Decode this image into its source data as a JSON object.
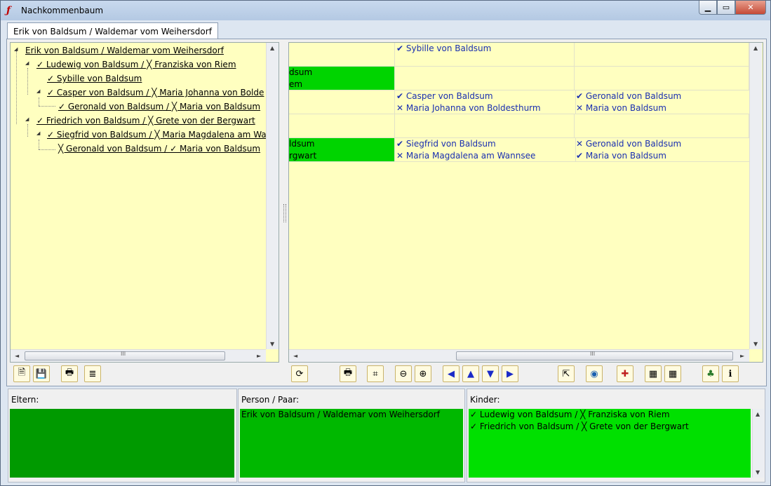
{
  "window": {
    "title": "Nachkommenbaum",
    "buttons": {
      "minimize": "▁",
      "maximize": "▭",
      "close": "✕"
    }
  },
  "tab": {
    "label": "Erik von Baldsum / Waldemar vom Weihersdorf"
  },
  "tree": {
    "nodes": [
      {
        "text": "Erik von Baldsum / Waldemar vom Weihersdorf",
        "level": 0
      },
      {
        "text": "✓ Ludewig von Baldsum / ╳ Franziska von Riem",
        "level": 1
      },
      {
        "text": "✓ Sybille von Baldsum",
        "level": 2
      },
      {
        "text": "✓ Casper von Baldsum / ╳ Maria Johanna von Bolde",
        "level": 2
      },
      {
        "text": "✓ Geronald von Baldsum / ╳ Maria von Baldsum",
        "level": 3
      },
      {
        "text": "✓ Friedrich von Baldsum / ╳ Grete von der Bergwart",
        "level": 1
      },
      {
        "text": "✓ Siegfrid von Baldsum / ╳ Maria Magdalena am Wa",
        "level": 2
      },
      {
        "text": "╳ Geronald von Baldsum / ✓ Maria von Baldsum",
        "level": 3
      }
    ]
  },
  "grid": {
    "r0c1": [
      "✔ Sybille von Baldsum"
    ],
    "r1c0": [
      "dsum",
      "em"
    ],
    "r2c1": [
      "✔ Casper von Baldsum",
      "✕ Maria Johanna von Boldesthurm"
    ],
    "r2c2": [
      "✔ Geronald von Baldsum",
      "✕ Maria von Baldsum"
    ],
    "r4c0": [
      "ldsum",
      "rgwart"
    ],
    "r4c1": [
      "✔ Siegfrid von Baldsum",
      "✕ Maria Magdalena am Wannsee"
    ],
    "r4c2": [
      "✕ Geronald von Baldsum",
      "✔ Maria von Baldsum"
    ]
  },
  "left_toolbar": [
    "new-doc-icon",
    "save-icon",
    "print-icon",
    "notes-icon"
  ],
  "right_toolbar": [
    "refresh-icon",
    "print-icon",
    "binoculars-icon",
    "zoom-out-icon",
    "zoom-in-icon",
    "arrow-left-icon",
    "arrow-up-icon",
    "arrow-down-icon",
    "arrow-right-icon",
    "export-icon",
    "globe-icon",
    "gift-icon",
    "chart-icon",
    "chart2-icon",
    "tree-icon",
    "info-icon"
  ],
  "bottom": {
    "eltern": {
      "label": "Eltern:"
    },
    "person": {
      "label": "Person / Paar:",
      "value": "Erik von Baldsum / Waldemar vom Weihersdorf"
    },
    "kinder": {
      "label": "Kinder:",
      "items": [
        "✓ Ludewig von Baldsum / ╳ Franziska von Riem",
        "✓ Friedrich von Baldsum / ╳ Grete von der Bergwart"
      ]
    }
  },
  "scroll": {
    "up": "▲",
    "down": "▼",
    "left": "◄",
    "right": "►",
    "grip": "III"
  },
  "colors": {
    "tree_bg": "#ffffc0",
    "green_cell": "#00d400",
    "eltern_bg": "#009a00",
    "person_bg": "#00b800",
    "kinder_bg": "#00e000",
    "link_blue": "#1a2fb0"
  }
}
